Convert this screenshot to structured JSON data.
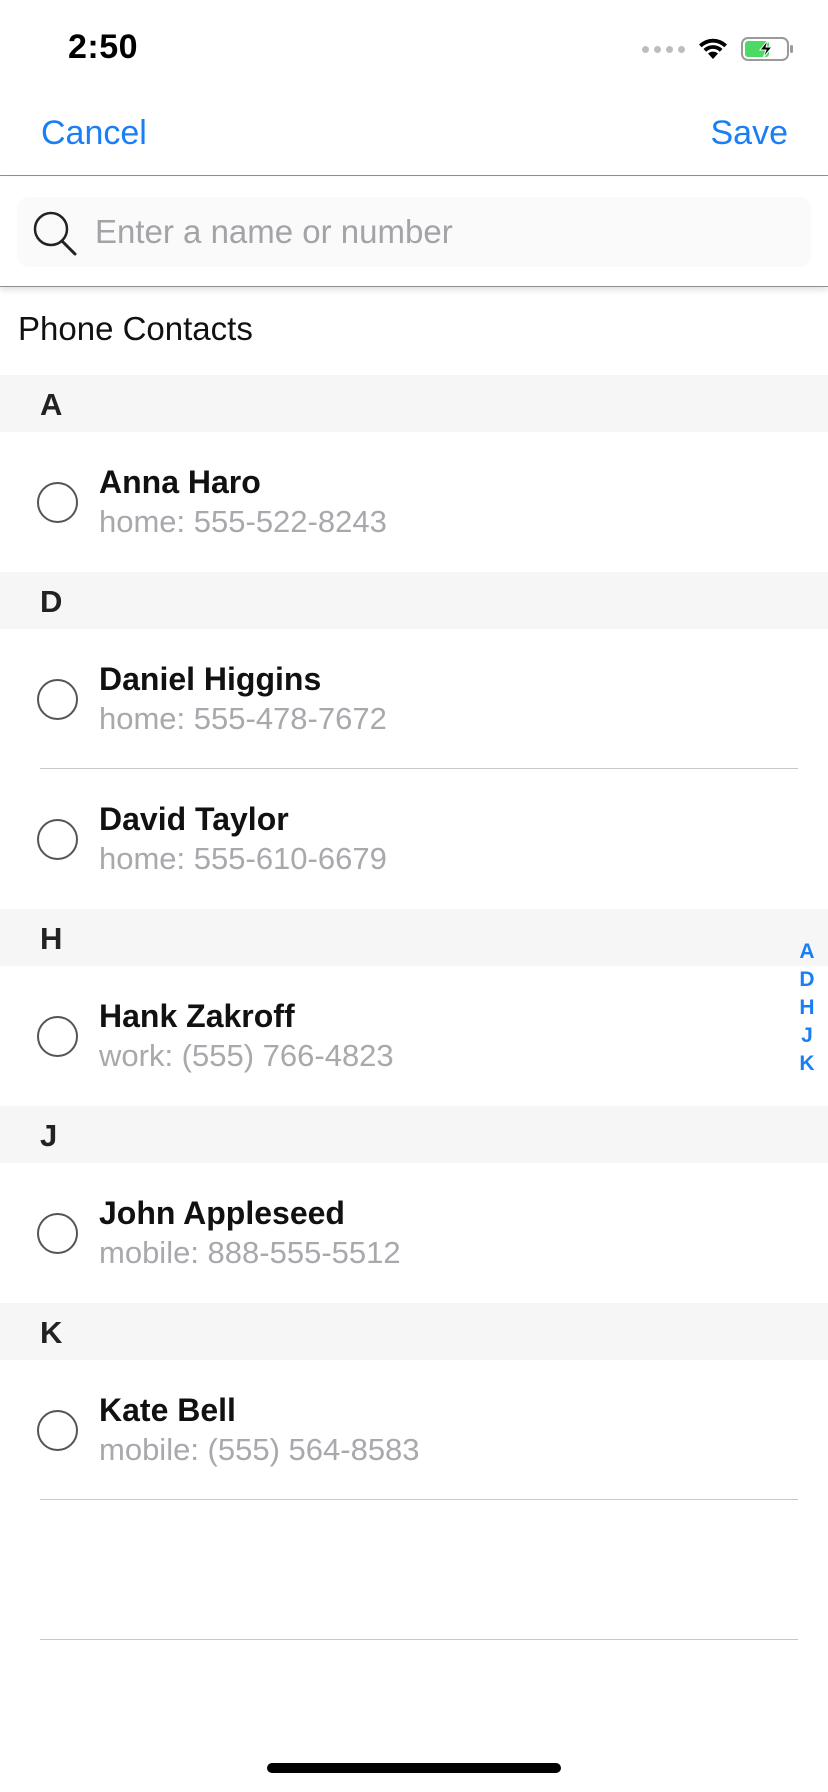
{
  "status_bar": {
    "time": "2:50"
  },
  "nav": {
    "cancel_label": "Cancel",
    "save_label": "Save",
    "accent_color": "#1a7ff5"
  },
  "search": {
    "placeholder": "Enter a name or number",
    "value": ""
  },
  "list_title": "Phone Contacts",
  "sections": [
    {
      "letter": "A",
      "contacts": [
        {
          "name": "Anna Haro",
          "detail": "home: 555-522-8243",
          "selected": false
        }
      ]
    },
    {
      "letter": "D",
      "contacts": [
        {
          "name": "Daniel Higgins",
          "detail": "home: 555-478-7672",
          "selected": false
        },
        {
          "name": "David Taylor",
          "detail": "home: 555-610-6679",
          "selected": false
        }
      ]
    },
    {
      "letter": "H",
      "contacts": [
        {
          "name": "Hank Zakroff",
          "detail": "work: (555) 766-4823",
          "selected": false
        }
      ]
    },
    {
      "letter": "J",
      "contacts": [
        {
          "name": "John Appleseed",
          "detail": "mobile: 888-555-5512",
          "selected": false
        }
      ]
    },
    {
      "letter": "K",
      "contacts": [
        {
          "name": "Kate Bell",
          "detail": "mobile: (555) 564-8583",
          "selected": false
        }
      ]
    }
  ],
  "index": [
    "A",
    "D",
    "H",
    "J",
    "K"
  ]
}
